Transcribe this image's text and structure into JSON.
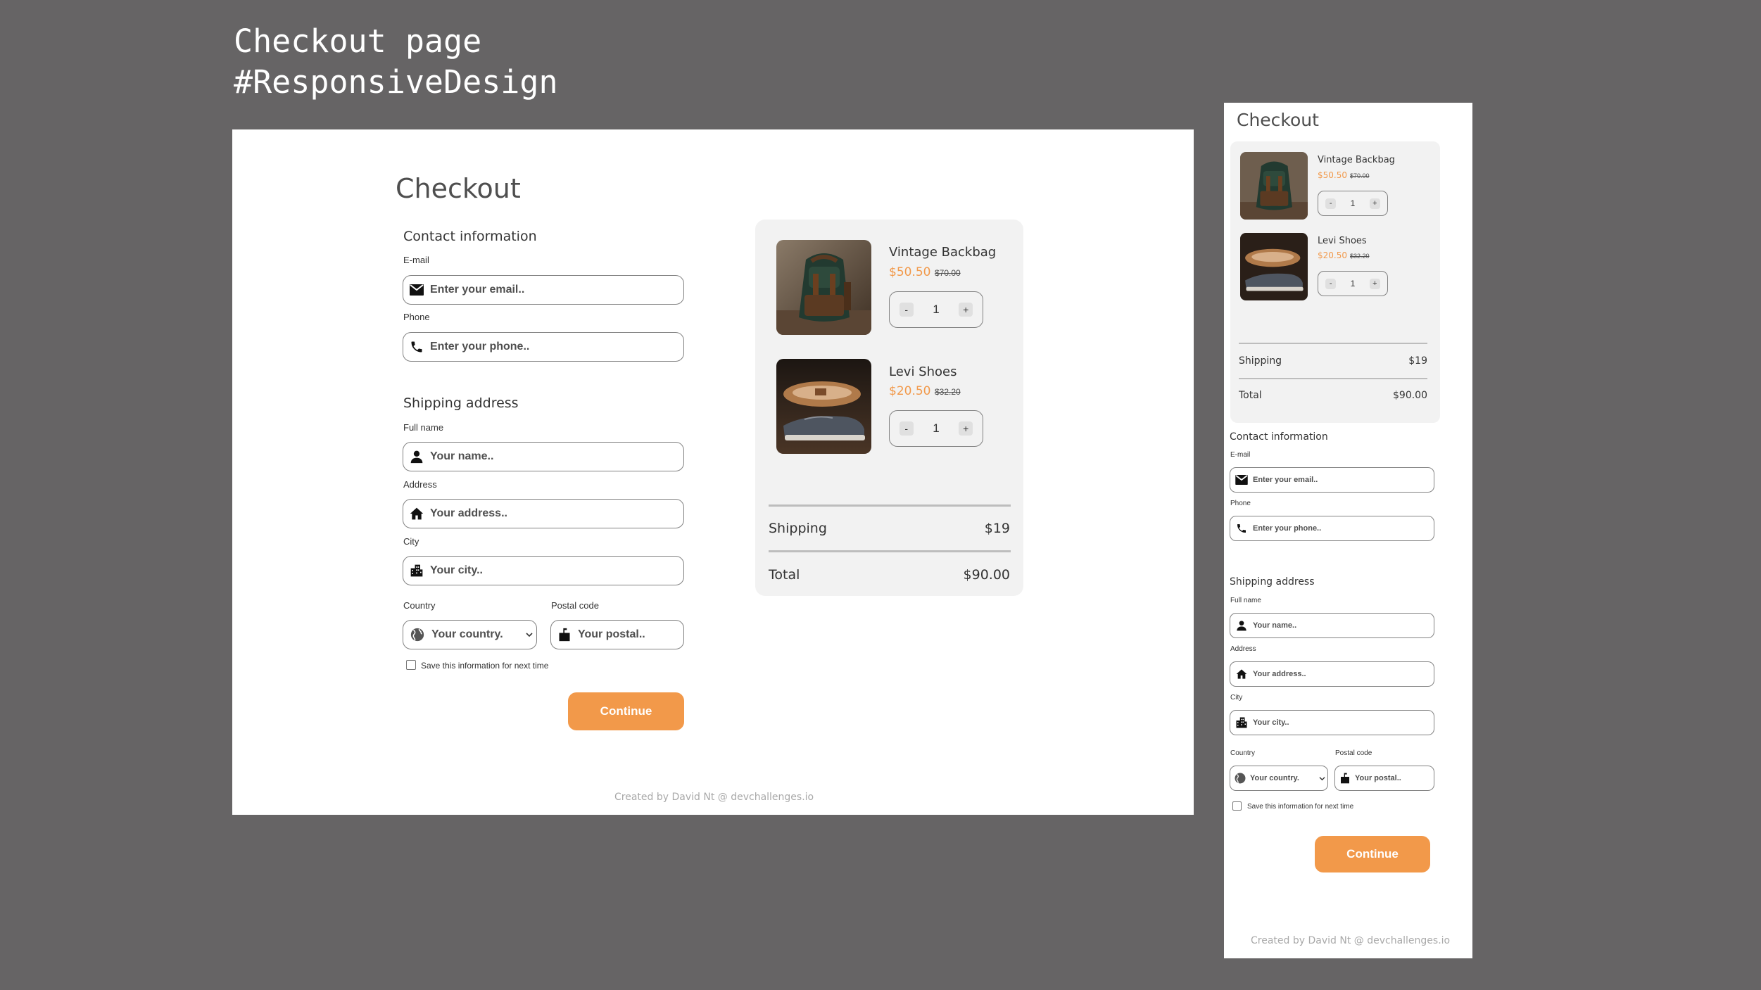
{
  "heading": {
    "line1": "Checkout page",
    "line2": "#ResponsiveDesign"
  },
  "checkout": {
    "title": "Checkout",
    "contact": {
      "title": "Contact information",
      "email_label": "E-mail",
      "email_placeholder": "Enter your email..",
      "phone_label": "Phone",
      "phone_placeholder": "Enter your phone.."
    },
    "shipping": {
      "title": "Shipping address",
      "name_label": "Full name",
      "name_placeholder": "Your name..",
      "address_label": "Address",
      "address_placeholder": "Your address..",
      "city_label": "City",
      "city_placeholder": "Your city..",
      "country_label": "Country",
      "country_placeholder": "Your country.",
      "postal_label": "Postal code",
      "postal_placeholder": "Your postal.."
    },
    "save_label": "Save this information for next time",
    "continue_label": "Continue",
    "products": [
      {
        "name": "Vintage Backbag",
        "price": "$50.50",
        "old_price": "$70.00",
        "qty": "1"
      },
      {
        "name": "Levi Shoes",
        "price": "$20.50",
        "old_price": "$32.20",
        "qty": "1"
      }
    ],
    "stepper": {
      "minus": "-",
      "plus": "+"
    },
    "shipping_label": "Shipping",
    "shipping_value": "$19",
    "total_label": "Total",
    "total_value": "$90.00",
    "credit": "Created by David Nt @ devchallenges.io"
  },
  "colors": {
    "accent": "#f2994a",
    "backdrop": "#666465",
    "summary_bg": "#f2f2f2"
  },
  "icons": [
    "envelope-icon",
    "phone-icon",
    "person-icon",
    "home-icon",
    "city-icon",
    "globe-icon",
    "mailbox-icon",
    "chevron-down-icon"
  ]
}
